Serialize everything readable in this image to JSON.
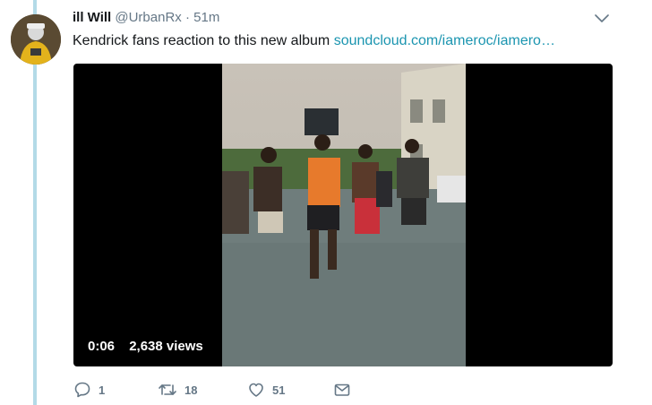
{
  "tweet": {
    "display_name": "ill Will",
    "handle": "@UrbanRx",
    "separator": "·",
    "time": "51m",
    "text": "Kendrick fans reaction to this new album",
    "link": "soundcloud.com/iameroc/iamero…"
  },
  "video": {
    "duration": "0:06",
    "views": "2,638 views"
  },
  "actions": {
    "replies": "1",
    "retweets": "18",
    "likes": "51"
  },
  "colors": {
    "thread_line": "#b3dae7",
    "link": "#1b95b0",
    "muted": "#657786"
  },
  "icons": {
    "more": "chevron-down-icon",
    "reply": "reply-bubble-icon",
    "retweet": "retweet-arrows-icon",
    "like": "heart-icon",
    "message": "envelope-icon"
  }
}
